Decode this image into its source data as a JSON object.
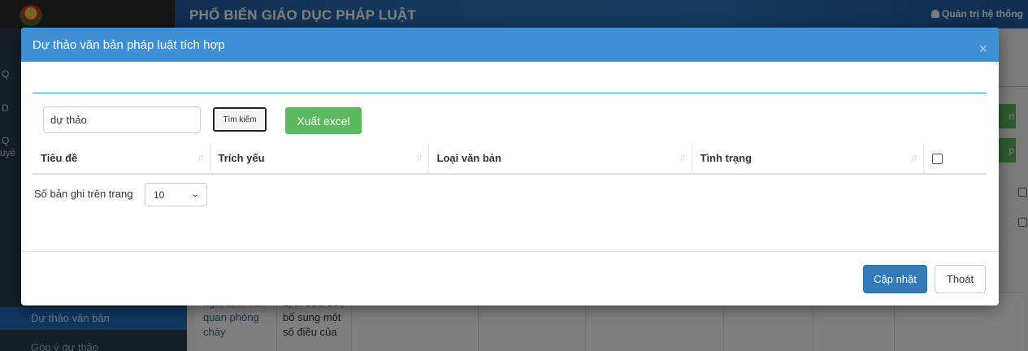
{
  "background": {
    "app_title": "PHỔ BIẾN GIÁO DỤC PHÁP LUẬT",
    "user_label": "Quản trị hệ thống",
    "sidebar_fragments": [
      "Q",
      "D",
      "Q",
      "uyề"
    ],
    "sidebar_items": [
      "Dự thảo văn bản",
      "Góp ý dự thảo"
    ],
    "action_fragments": [
      "ri",
      "p"
    ],
    "table_text_col1": "nghị định liên quan phòng cháy",
    "table_text_col2": "định sửa đổi, bổ sung một số điều của"
  },
  "modal": {
    "title": "Dự thảo văn bản pháp luật tích hợp",
    "close_symbol": "×",
    "search": {
      "value": "dự thảo",
      "button_label": "Tìm kiếm"
    },
    "export_label": "Xuất excel",
    "columns": [
      "Tiêu đề",
      "Trích yếu",
      "Loại văn bản",
      "Tình trạng"
    ],
    "page_length": {
      "label": "Số bản ghi trên trang",
      "selected": "10"
    },
    "footer": {
      "update_label": "Cập nhật",
      "exit_label": "Thoát"
    }
  },
  "colors": {
    "modal_header": "#3f8fd6",
    "primary_button": "#337ab7",
    "success_button": "#5cb85c"
  }
}
